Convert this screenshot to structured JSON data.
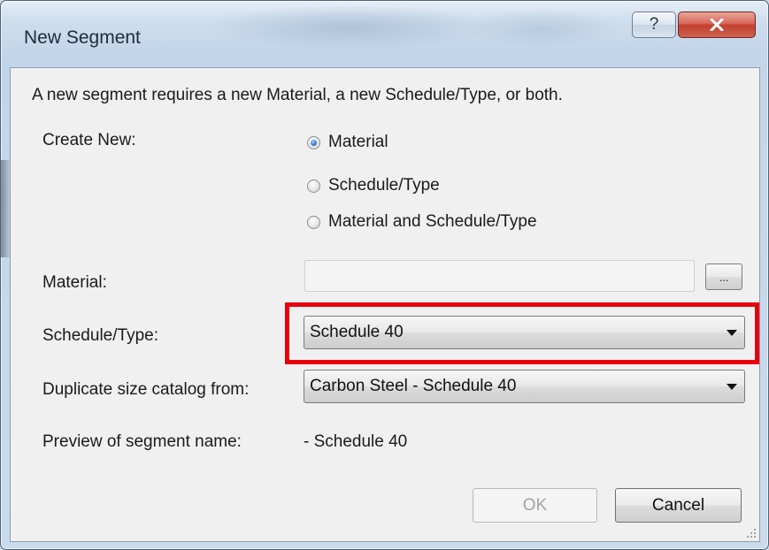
{
  "window": {
    "title": "New Segment",
    "help_label": "?",
    "close_icon": "close-icon"
  },
  "dialog": {
    "instructions": "A new segment requires a new Material, a new Schedule/Type, or both.",
    "create_new": {
      "label": "Create New:",
      "options": [
        "Material",
        "Schedule/Type",
        "Material and Schedule/Type"
      ],
      "selected": "Material"
    },
    "material": {
      "label": "Material:",
      "value": "",
      "browse_label": "..."
    },
    "schedule_type": {
      "label": "Schedule/Type:",
      "value": "Schedule 40"
    },
    "duplicate_catalog": {
      "label": "Duplicate size catalog from:",
      "value": "Carbon Steel - Schedule 40"
    },
    "preview": {
      "label": "Preview of segment name:",
      "value": "- Schedule 40"
    },
    "buttons": {
      "ok": "OK",
      "cancel": "Cancel"
    }
  },
  "colors": {
    "highlight": "#e8000b",
    "close_button": "#c2402f",
    "radio_selected": "#1e68b9"
  }
}
